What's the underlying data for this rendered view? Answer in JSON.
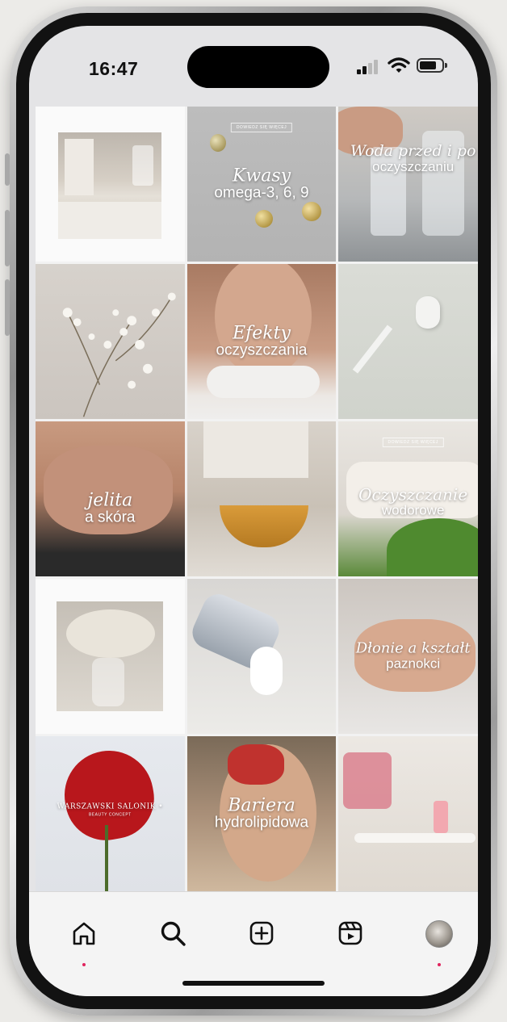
{
  "status_bar": {
    "time": "16:47",
    "icons": [
      "signal-bars-icon",
      "wifi-icon",
      "battery-icon"
    ],
    "battery_level": 0.75
  },
  "grid": {
    "tiles": [
      {
        "title": "",
        "subtitle": "",
        "badge": "",
        "theme": "bedroom-photo"
      },
      {
        "title": "Kwasy",
        "subtitle": "omega-3, 6, 9",
        "badge": "DOWIEDZ SIĘ WIĘCEJ",
        "theme": "capsules"
      },
      {
        "title": "Woda przed i po",
        "subtitle": "oczyszczaniu",
        "badge": "",
        "theme": "water-bottles"
      },
      {
        "title": "",
        "subtitle": "",
        "badge": "",
        "theme": "gypsophila"
      },
      {
        "title": "Efekty",
        "subtitle": "oczyszczania",
        "badge": "",
        "theme": "face-treatment"
      },
      {
        "title": "",
        "subtitle": "",
        "badge": "",
        "theme": "dropper"
      },
      {
        "title": "jelita",
        "subtitle": "a skóra",
        "badge": "",
        "theme": "heart-hands"
      },
      {
        "title": "",
        "subtitle": "",
        "badge": "",
        "theme": "bowl"
      },
      {
        "title": "Oczyszczanie",
        "subtitle": "wodorowe",
        "badge": "DOWIEDZ SIĘ WIĘCEJ",
        "theme": "spa-bed"
      },
      {
        "title": "",
        "subtitle": "",
        "badge": "",
        "theme": "vase-photo"
      },
      {
        "title": "",
        "subtitle": "",
        "badge": "",
        "theme": "cream-tube"
      },
      {
        "title": "Dłonie a kształt",
        "subtitle": "paznokci",
        "badge": "",
        "theme": "hands"
      },
      {
        "title": "WARSZAWSKI SALONIK •",
        "subtitle": "BEAUTY CONCEPT",
        "badge": "",
        "theme": "anthurium"
      },
      {
        "title": "Bariera",
        "subtitle": "hydrolipidowa",
        "badge": "",
        "theme": "starfish-portrait"
      },
      {
        "title": "",
        "subtitle": "",
        "badge": "",
        "theme": "vanity"
      }
    ]
  },
  "bottom_nav": {
    "items": [
      {
        "name": "home-icon",
        "active": false,
        "dot": true
      },
      {
        "name": "search-icon",
        "active": true,
        "dot": false
      },
      {
        "name": "create-post-icon",
        "active": false,
        "dot": false
      },
      {
        "name": "reels-icon",
        "active": false,
        "dot": false
      },
      {
        "name": "profile-avatar",
        "active": false,
        "dot": true
      }
    ]
  }
}
